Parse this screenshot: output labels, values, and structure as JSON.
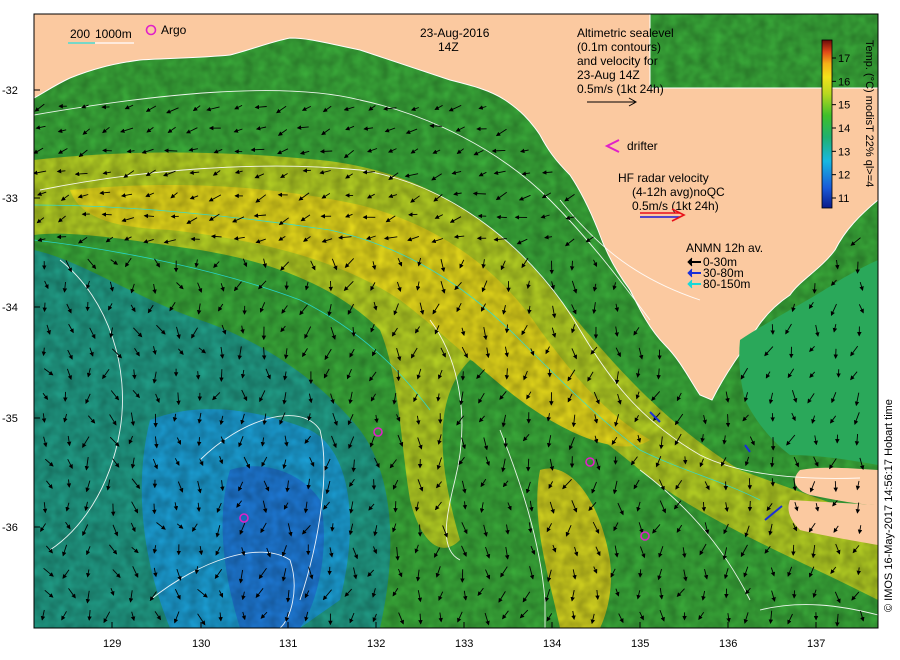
{
  "map": {
    "date": "23-Aug-2016",
    "time": "14Z",
    "depth_legend": {
      "label_200": "200",
      "label_1000": "1000m",
      "argo": "Argo"
    },
    "altimetry": {
      "line1": "Altimetric sealevel",
      "line2": "(0.1m contours)",
      "line3": "and velocity for",
      "line4": "23-Aug 14Z",
      "line5": "0.5m/s (1kt 24h)"
    },
    "drifter": "drifter",
    "hf_radar": {
      "line1": "HF radar velocity",
      "line2": "(4-12h avg)noQC",
      "line3": "0.5m/s (1kt 24h)"
    },
    "anmn": {
      "title": "ANMN 12h av.",
      "d1": "0-30m",
      "d2": "30-80m",
      "d3": "80-150m"
    },
    "colorbar": {
      "title": "Temp. (°C) modisT 22% ql>=4",
      "ticks": [
        "11",
        "12",
        "13",
        "14",
        "15",
        "16",
        "17"
      ]
    },
    "credit": "© IMOS 16-May-2017 14:56:17 Hobart time",
    "lat_ticks": [
      "-32",
      "-33",
      "-34",
      "-35",
      "-36"
    ],
    "lon_ticks": [
      "129",
      "130",
      "131",
      "132",
      "133",
      "134",
      "135",
      "136",
      "137"
    ],
    "colors": {
      "land": "#fbc9a0",
      "cold": "#1aa5e0",
      "mid": "#2fb04b",
      "warm": "#e6df1a",
      "contour": "#ffffff",
      "argo": "#e020c8",
      "hf_red": "#e8101a",
      "hf_blue": "#1a1ad8",
      "anmn_black": "#000000",
      "anmn_blue": "#1a30d8",
      "anmn_cyan": "#18d8d8"
    }
  }
}
